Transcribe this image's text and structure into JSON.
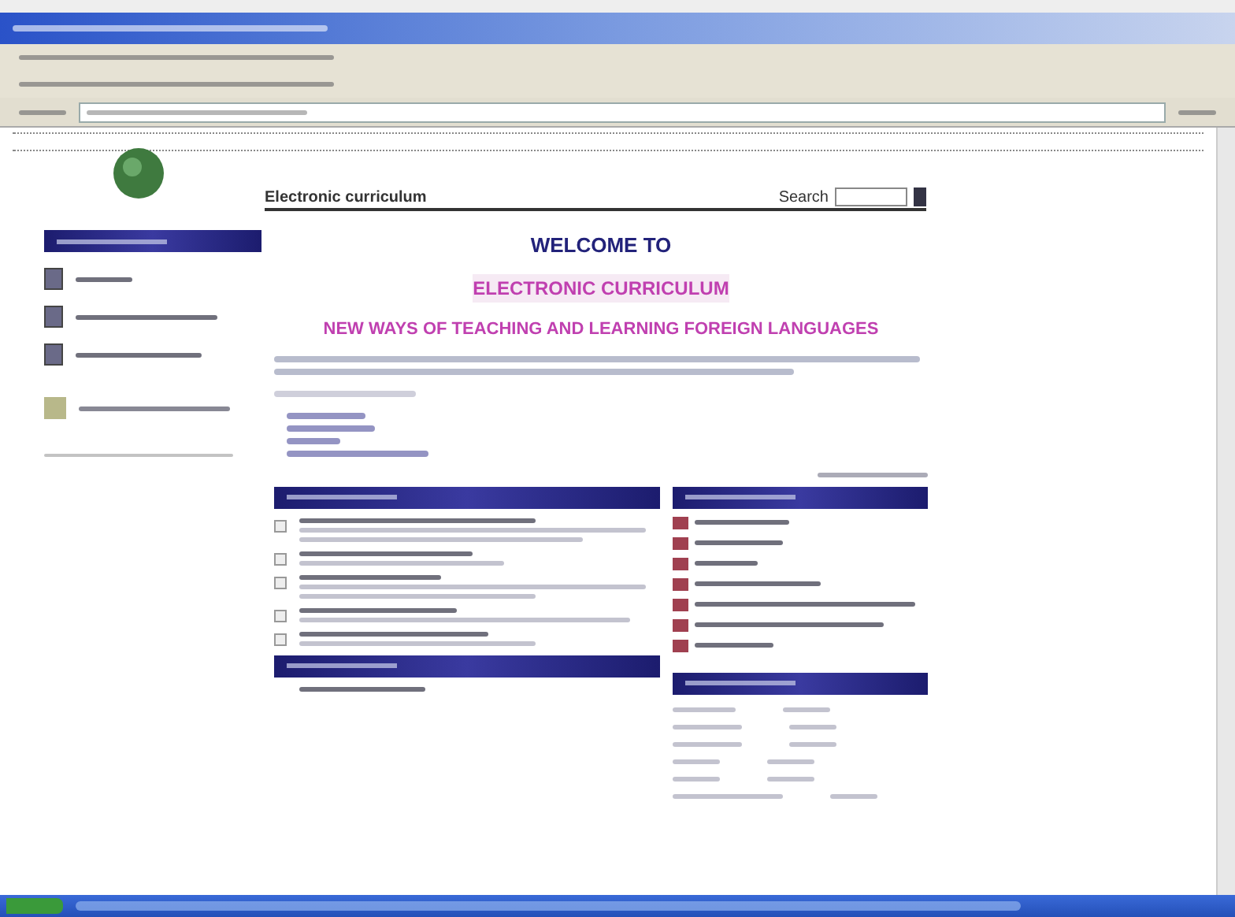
{
  "header": {
    "title": "Electronic curriculum",
    "search_label": "Search"
  },
  "welcome": {
    "line_1": "WELCOME TO",
    "line_2": "ELECTRONIC CURRICULUM",
    "line_3": "NEW WAYS OF TEACHING AND LEARNING FOREIGN LANGUAGES"
  }
}
